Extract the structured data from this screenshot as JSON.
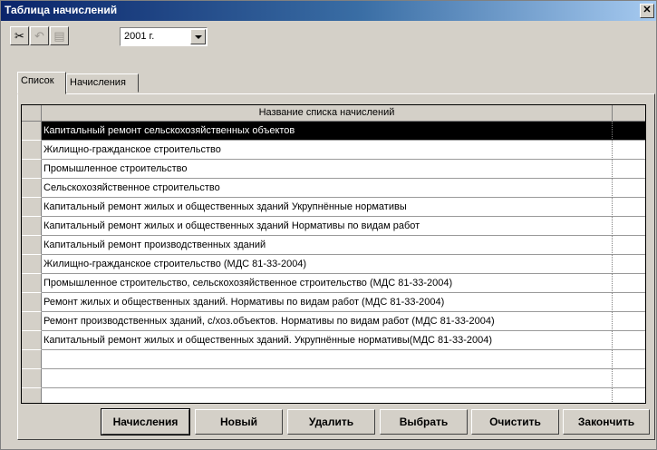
{
  "window": {
    "title": "Таблица начислений"
  },
  "toolbar": {
    "year_value": "2001 г."
  },
  "tabs": [
    {
      "label": "Список",
      "active": true
    },
    {
      "label": "Начисления",
      "active": false
    }
  ],
  "grid": {
    "header": "Название списка начислений",
    "rows": [
      "Капитальный ремонт сельскохозяйственных объектов",
      "Жилищно-гражданское строительство",
      "Промышленное строительство",
      "Сельскохозяйственное строительство",
      "Капитальный ремонт жилых и общественных зданий Укрупнённые нормативы",
      "Капитальный ремонт жилых и общественных зданий Нормативы по видам работ",
      "Капитальный ремонт производственных зданий",
      "Жилищно-гражданское строительство (МДС 81-33-2004)",
      "Промышленное строительство, сельскохозяйственное строительство (МДС 81-33-2004)",
      "Ремонт жилых и общественных зданий. Нормативы по видам работ (МДС 81-33-2004)",
      "Ремонт производственных зданий, с/хоз.объектов. Нормативы по видам работ (МДС 81-33-2004)",
      "Капитальный ремонт жилых и общественных зданий. Укрупнённые нормативы(МДС 81-33-2004)"
    ],
    "selected_index": 0
  },
  "buttons": {
    "accruals": "Начисления",
    "new": "Новый",
    "delete": "Удалить",
    "select": "Выбрать",
    "clear": "Очистить",
    "finish": "Закончить"
  },
  "icons": {
    "cut": "scissors-icon",
    "undo": "undo-icon",
    "paste": "paste-icon",
    "close": "close-icon",
    "dropdown": "chevron-down-icon"
  },
  "colors": {
    "titlebar": "#0a246a",
    "face": "#d4d0c8",
    "selection": "#000000"
  }
}
